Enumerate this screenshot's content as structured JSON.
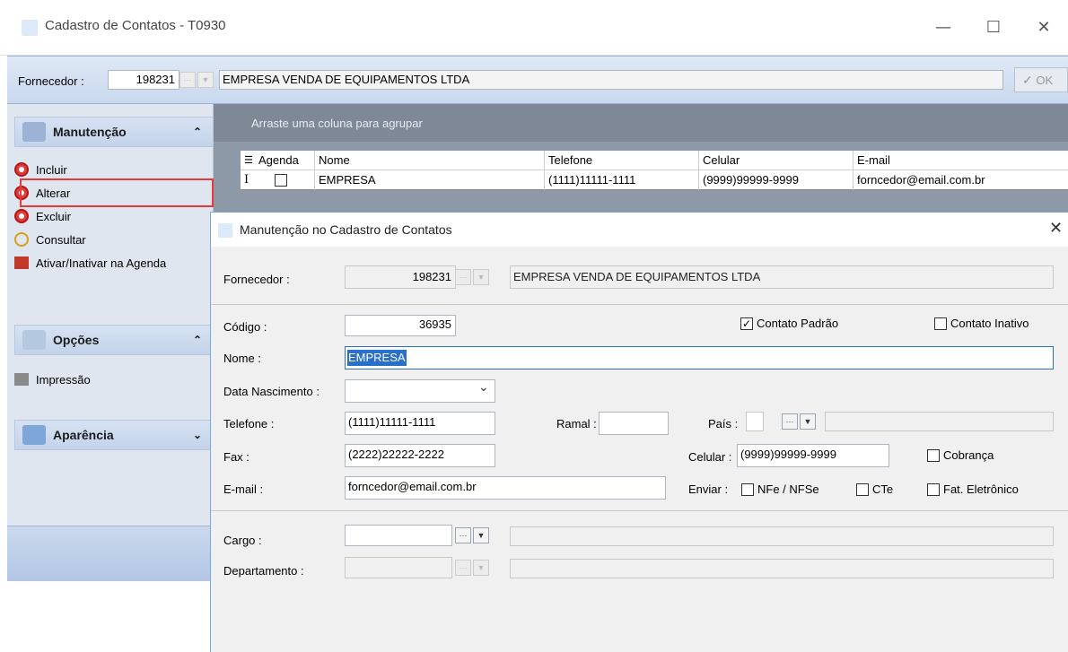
{
  "window": {
    "title": "Cadastro de Contatos - T0930",
    "minimize_glyph": "—",
    "maximize_glyph": "☐",
    "close_glyph": "✕"
  },
  "supplier_bar": {
    "label": "Fornecedor :",
    "code": "198231",
    "name": "EMPRESA VENDA DE EQUIPAMENTOS LTDA",
    "ok_label": "OK"
  },
  "sidebar": {
    "groups": [
      {
        "title": "Manutenção",
        "chevron": "≈",
        "items": [
          "Incluir",
          "Alterar",
          "Excluir",
          "Consultar",
          "Ativar/Inativar na Agenda"
        ]
      },
      {
        "title": "Opções",
        "chevron": "≈",
        "items": [
          "Impressão"
        ]
      },
      {
        "title": "Aparência",
        "chevron": "≈",
        "items": []
      }
    ],
    "highlight_color": "#e83a3a"
  },
  "grid": {
    "group_hint": "Arraste uma coluna para agrupar",
    "columns": [
      "Agenda",
      "Nome",
      "Telefone",
      "Celular",
      "E-mail"
    ],
    "rows": [
      {
        "marker": "I",
        "agenda": "",
        "nome": "EMPRESA",
        "telefone": "(1111)11111-1111",
        "celular": "(9999)99999-9999",
        "email": "forncedor@email.com.br"
      }
    ]
  },
  "dialog": {
    "title": "Manutenção no Cadastro de Contatos",
    "close_glyph": "✕",
    "fornecedor_label": "Fornecedor :",
    "fornecedor_code": "198231",
    "fornecedor_name": "EMPRESA VENDA DE EQUIPAMENTOS LTDA",
    "codigo_label": "Código :",
    "codigo_value": "36935",
    "contato_padrao_label": "Contato Padrão",
    "contato_padrao_checked": "✓",
    "contato_inativo_label": "Contato Inativo",
    "nome_label": "Nome :",
    "nome_value": "EMPRESA",
    "data_nasc_label": "Data Nascimento :",
    "data_nasc_value": "",
    "telefone_label": "Telefone :",
    "telefone_value": "(1111)11111-1111",
    "ramal_label": "Ramal :",
    "ramal_value": "",
    "pais_label": "País :",
    "fax_label": "Fax :",
    "fax_value": "(2222)22222-2222",
    "celular_label": "Celular :",
    "celular_value": "(9999)99999-9999",
    "cobranca_label": "Cobrança",
    "email_label": "E-mail :",
    "email_value": "forncedor@email.com.br",
    "enviar_label": "Enviar :",
    "nfe_label": "NFe / NFSe",
    "cte_label": "CTe",
    "fat_label": "Fat. Eletrônico",
    "cargo_label": "Cargo :",
    "departamento_label": "Departamento :",
    "ellipsis": "···",
    "dropdown_arrow": "▼",
    "chevron_down": "⌄",
    "selection_color": "#2a6fc9"
  }
}
